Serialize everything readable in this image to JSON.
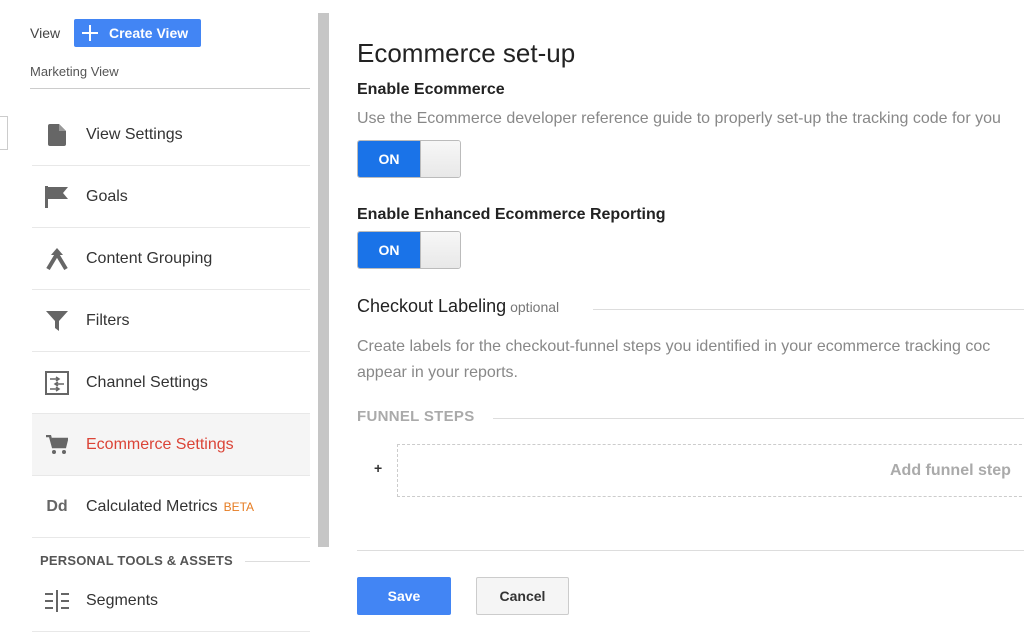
{
  "sidebar": {
    "view_label": "View",
    "create_view_label": "Create View",
    "view_name": "Marketing View",
    "items": [
      {
        "label": "View Settings",
        "icon": "document-icon"
      },
      {
        "label": "Goals",
        "icon": "flag-icon"
      },
      {
        "label": "Content Grouping",
        "icon": "content-grouping-icon"
      },
      {
        "label": "Filters",
        "icon": "filter-icon"
      },
      {
        "label": "Channel Settings",
        "icon": "channel-settings-icon"
      },
      {
        "label": "Ecommerce Settings",
        "icon": "cart-icon",
        "active": true
      },
      {
        "label": "Calculated Metrics",
        "badge": "BETA",
        "icon": "calculated-metrics-icon",
        "icon_text": "Dd"
      }
    ],
    "section_heading": "PERSONAL TOOLS & ASSETS",
    "personal_items": [
      {
        "label": "Segments",
        "icon": "segments-icon"
      }
    ]
  },
  "main": {
    "title": "Ecommerce set-up",
    "enable_ecommerce": {
      "heading": "Enable Ecommerce",
      "description": "Use the Ecommerce developer reference guide to properly set-up the tracking code for you",
      "toggle_label": "ON",
      "state": "on"
    },
    "enhanced": {
      "heading": "Enable Enhanced Ecommerce Reporting",
      "toggle_label": "ON",
      "state": "on"
    },
    "checkout": {
      "heading": "Checkout Labeling",
      "optional": "optional",
      "description_line1": "Create labels for the checkout-funnel steps you identified in your ecommerce tracking coc",
      "description_line2": "appear in your reports.",
      "funnel_heading": "FUNNEL STEPS",
      "plus": "+",
      "add_step": "Add funnel step"
    },
    "save_label": "Save",
    "cancel_label": "Cancel"
  },
  "colors": {
    "accent": "#4285f4",
    "toggle_on": "#1a73e8",
    "active_nav": "#db4437",
    "beta": "#e67c22"
  }
}
